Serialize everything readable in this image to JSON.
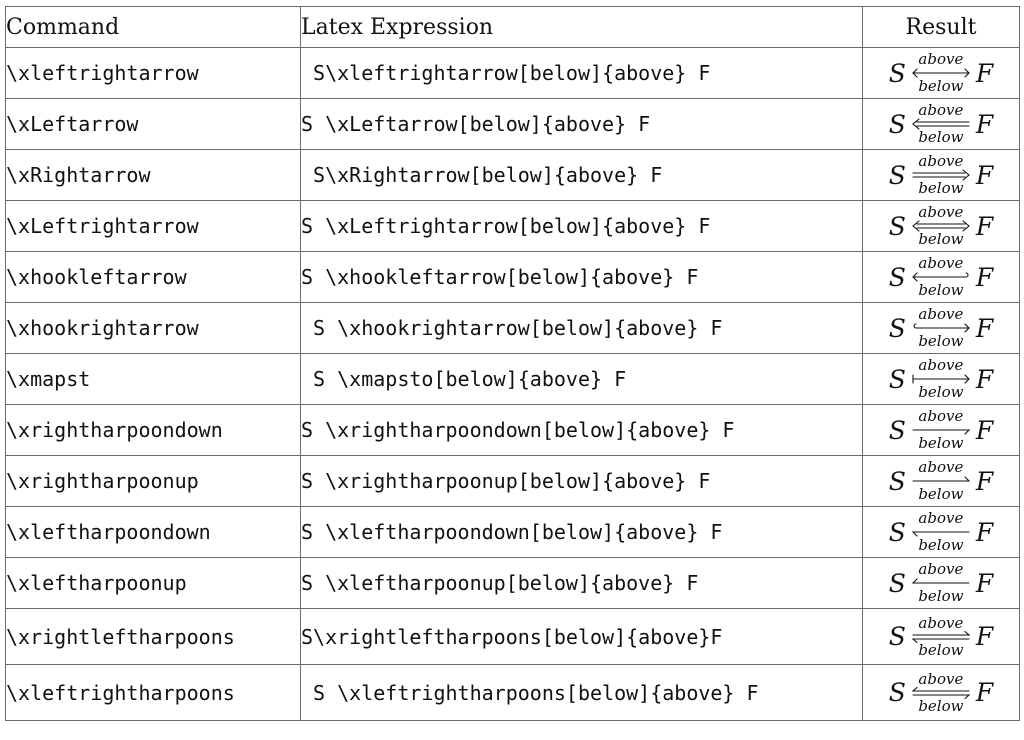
{
  "table": {
    "headers": [
      "Command",
      "Latex Expression",
      "Result"
    ],
    "rows": [
      {
        "command": "\\xleftrightarrow",
        "expression": " S\\xleftrightarrow[below]{above} F",
        "arrow": "leftrightarrow",
        "left": "S",
        "above": "above",
        "below": "below",
        "right": "F"
      },
      {
        "command": "\\xLeftarrow",
        "expression": "S \\xLeftarrow[below]{above} F",
        "arrow": "Leftarrow",
        "left": "S",
        "above": "above",
        "below": "below",
        "right": "F"
      },
      {
        "command": "\\xRightarrow",
        "expression": " S\\xRightarrow[below]{above} F",
        "arrow": "Rightarrow",
        "left": "S",
        "above": "above",
        "below": "below",
        "right": "F"
      },
      {
        "command": "\\xLeftrightarrow",
        "expression": "S \\xLeftrightarrow[below]{above} F",
        "arrow": "Leftrightarrow",
        "left": "S",
        "above": "above",
        "below": "below",
        "right": "F"
      },
      {
        "command": "\\xhookleftarrow",
        "expression": "S \\xhookleftarrow[below]{above} F",
        "arrow": "hookleftarrow",
        "left": "S",
        "above": "above",
        "below": "below",
        "right": "F"
      },
      {
        "command": "\\xhookrightarrow",
        "expression": " S \\xhookrightarrow[below]{above} F",
        "arrow": "hookrightarrow",
        "left": "S",
        "above": "above",
        "below": "below",
        "right": "F"
      },
      {
        "command": "\\xmapst",
        "expression": " S \\xmapsto[below]{above} F",
        "arrow": "mapsto",
        "left": "S",
        "above": "above",
        "below": "below",
        "right": "F"
      },
      {
        "command": "\\xrightharpoondown",
        "expression": "S \\xrightharpoondown[below]{above} F",
        "arrow": "rightharpoondown",
        "left": "S",
        "above": "above",
        "below": "below",
        "right": "F"
      },
      {
        "command": "\\xrightharpoonup",
        "expression": "S \\xrightharpoonup[below]{above} F",
        "arrow": "rightharpoonup",
        "left": "S",
        "above": "above",
        "below": "below",
        "right": "F"
      },
      {
        "command": "\\xleftharpoondown",
        "expression": "S \\xleftharpoondown[below]{above} F",
        "arrow": "leftharpoondown",
        "left": "S",
        "above": "above",
        "below": "below",
        "right": "F"
      },
      {
        "command": "\\xleftharpoonup",
        "expression": "S \\xleftharpoonup[below]{above} F",
        "arrow": "leftharpoonup",
        "left": "S",
        "above": "above",
        "below": "below",
        "right": "F"
      },
      {
        "command": "\\xrightleftharpoons",
        "expression": "S\\xrightleftharpoons[below]{above}F",
        "arrow": "rightleftharpoons",
        "left": "S",
        "above": "above",
        "below": "below",
        "right": "F"
      },
      {
        "command": "\\xleftrightharpoons",
        "expression": " S \\xleftrightharpoons[below]{above} F",
        "arrow": "leftrightharpoons",
        "left": "S",
        "above": "above",
        "below": "below",
        "right": "F"
      }
    ]
  }
}
